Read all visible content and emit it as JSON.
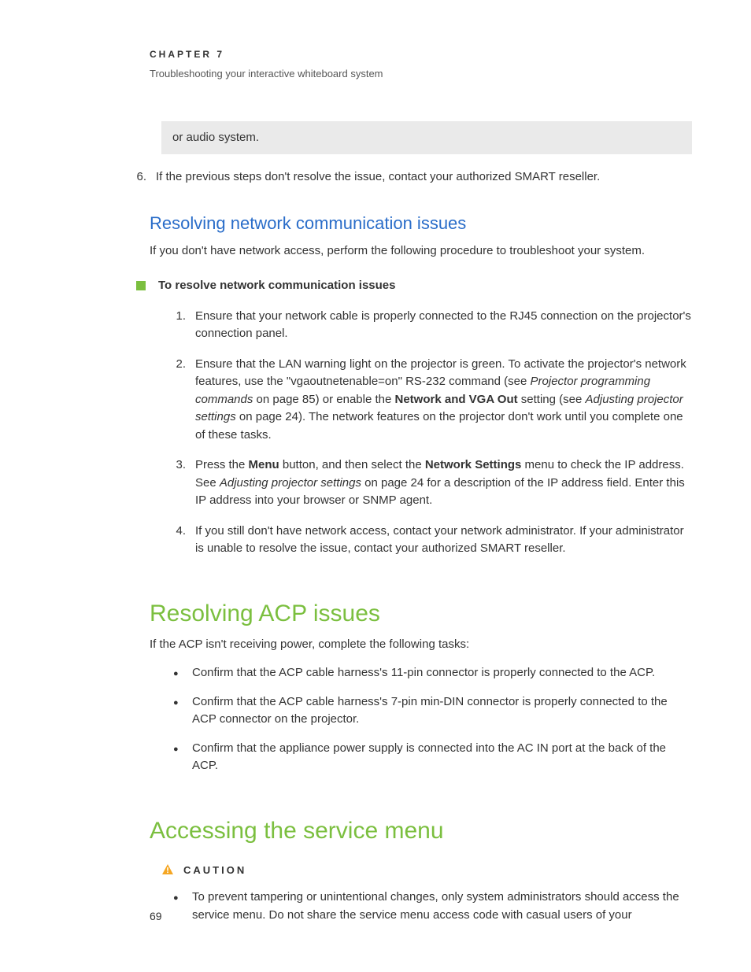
{
  "chapter": {
    "label": "CHAPTER 7",
    "subtitle": "Troubleshooting your interactive whiteboard system"
  },
  "gray_box": "or audio system.",
  "step6": {
    "num": "6.",
    "text": "If the previous steps don't resolve the issue, contact your authorized SMART reseller."
  },
  "network": {
    "heading": "Resolving network communication issues",
    "intro": "If you don't have network access, perform the following procedure to troubleshoot your system.",
    "procedure_title": "To resolve network communication issues",
    "steps": {
      "1": {
        "num": "1.",
        "text": "Ensure that your network cable is properly connected to the RJ45 connection on the projector's connection panel."
      },
      "2": {
        "num": "2.",
        "a": "Ensure that the LAN warning light on the projector is green. To activate the projector's network features, use the \"vgaoutnetenable=on\" RS-232 command (see ",
        "b": "Projector programming commands",
        "c": " on page 85) or enable the ",
        "d": "Network and VGA Out",
        "e": " setting (see ",
        "f": "Adjusting projector settings",
        "g": " on page 24). The network features on the projector don't work until you complete one of these tasks."
      },
      "3": {
        "num": "3.",
        "a": "Press the ",
        "b": "Menu",
        "c": " button, and then select the ",
        "d": "Network Settings",
        "e": " menu to check the IP address. See ",
        "f": "Adjusting projector settings",
        "g": " on page 24 for a description of the IP address field. Enter this IP address into your browser or SNMP agent."
      },
      "4": {
        "num": "4.",
        "text": "If you still don't have network access, contact your network administrator. If your administrator is unable to resolve the issue, contact your authorized SMART reseller."
      }
    }
  },
  "acp": {
    "heading": "Resolving ACP issues",
    "intro": "If the ACP isn't receiving power, complete the following tasks:",
    "bullets": {
      "0": "Confirm that the ACP cable harness's 11-pin connector is properly connected to the ACP.",
      "1": "Confirm that the ACP cable harness's 7-pin min-DIN connector is properly connected to the ACP connector on the projector.",
      "2": "Confirm that the appliance power supply is connected into the AC IN port at the back of the ACP."
    }
  },
  "service": {
    "heading": "Accessing the service menu",
    "caution_label": "CAUTION",
    "bullet": "To prevent tampering or unintentional changes, only system administrators should access the service menu. Do not share the service menu access code with casual users of your"
  },
  "page_number": "69"
}
